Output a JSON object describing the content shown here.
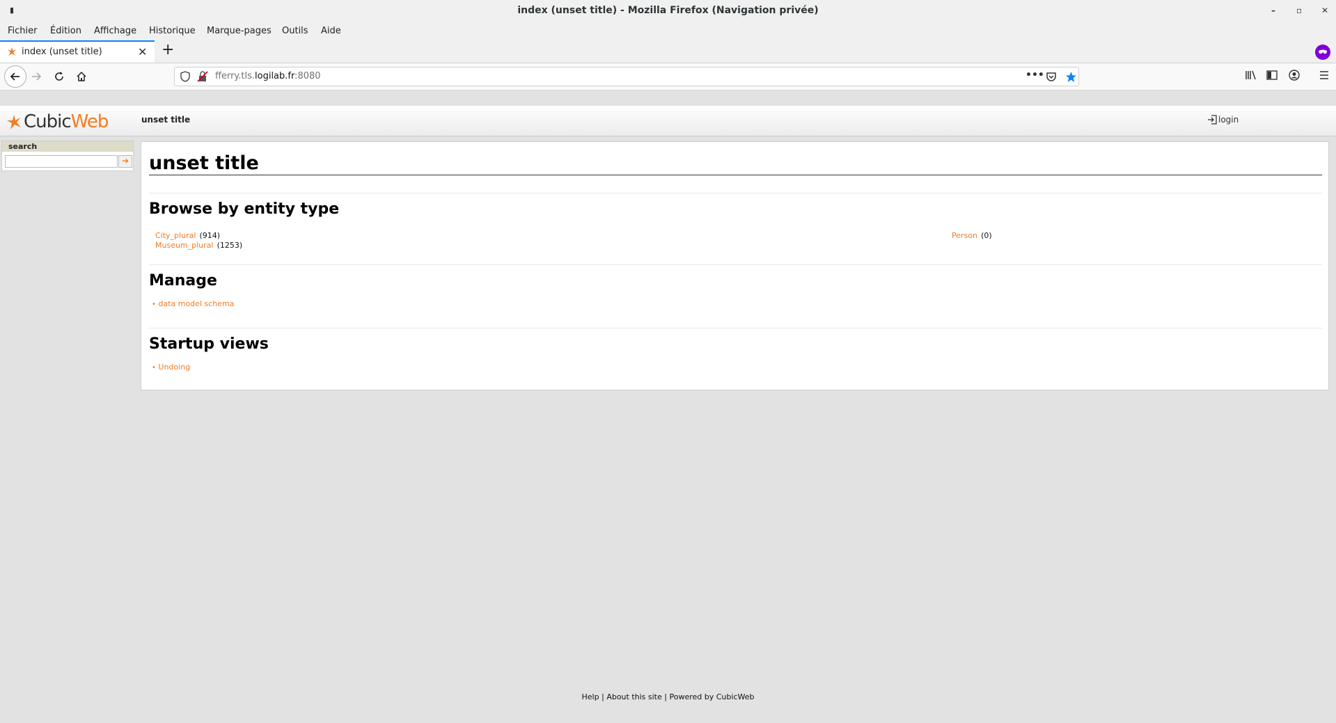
{
  "window": {
    "title": "index (unset title) - Mozilla Firefox (Navigation privée)"
  },
  "menu": {
    "items": [
      "Fichier",
      "Édition",
      "Affichage",
      "Historique",
      "Marque-pages",
      "Outils",
      "Aide"
    ]
  },
  "tab": {
    "title": "index (unset title)"
  },
  "urlbar": {
    "host_prefix": "fferry.tls.",
    "host_domain": "logilab.fr",
    "port": ":8080"
  },
  "site": {
    "logo_text_1": "Cubic",
    "logo_text_2": "Web",
    "page_name": "unset title",
    "login_label": "login"
  },
  "sidebar": {
    "search_heading": "search",
    "search_value": "",
    "search_button": "➔"
  },
  "main": {
    "title": "unset title",
    "browse": {
      "heading": "Browse by entity type",
      "entities": [
        {
          "label": "City_plural",
          "count": "(914)"
        },
        {
          "label": "Museum_plural",
          "count": "(1253)"
        },
        {
          "label": "Person",
          "count": "(0)"
        }
      ]
    },
    "manage": {
      "heading": "Manage",
      "links": [
        "data model schema"
      ]
    },
    "startup": {
      "heading": "Startup views",
      "links": [
        "Undoing"
      ]
    }
  },
  "footer": {
    "help": "Help",
    "about": "About this site",
    "powered": "Powered by CubicWeb",
    "sep": "|"
  },
  "colors": {
    "accent_orange": "#f47b20",
    "firefox_blue": "#0a84ff",
    "private_purple": "#8000d7",
    "page_bg": "#e2e2e2"
  }
}
